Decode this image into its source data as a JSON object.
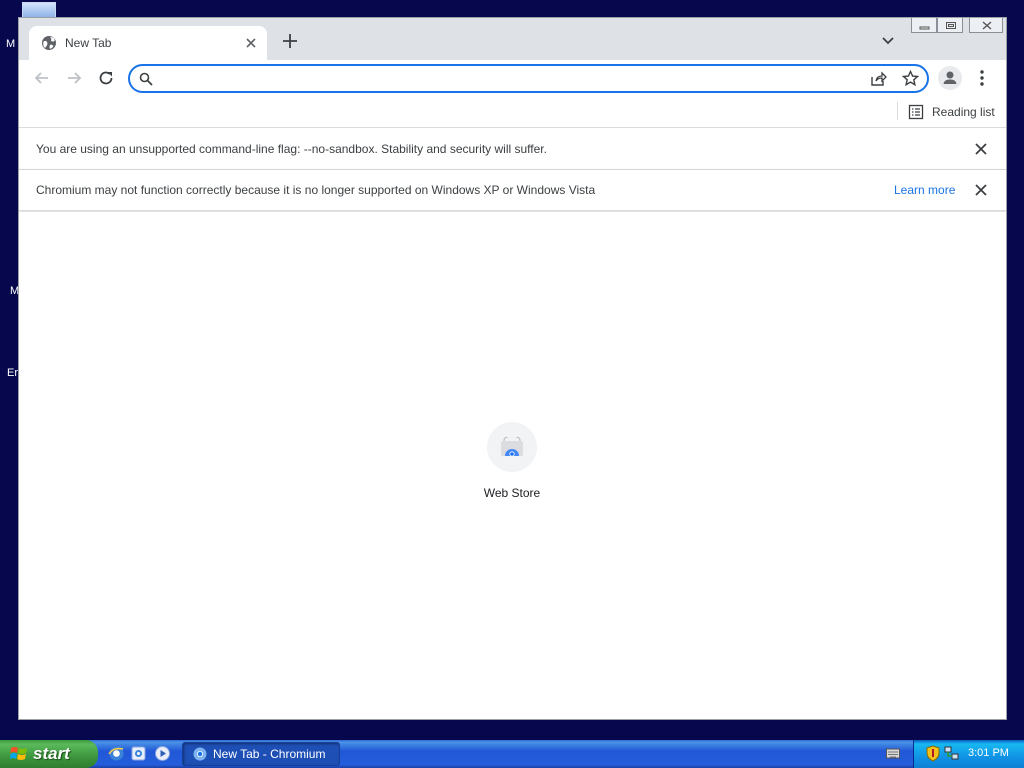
{
  "desktop": {
    "frag_1": "M",
    "frag_2": "M",
    "frag_3": "Er"
  },
  "browser": {
    "tab": {
      "title": "New Tab"
    },
    "omnibox": {
      "value": "",
      "placeholder": ""
    },
    "bookmarks_bar": {
      "reading_list_label": "Reading list"
    },
    "infobars": [
      {
        "message": "You are using an unsupported command-line flag: --no-sandbox. Stability and security will suffer."
      },
      {
        "message": "Chromium may not function correctly because it is no longer supported on Windows XP or Windows Vista",
        "link": "Learn more"
      }
    ],
    "new_tab_page": {
      "shortcuts": [
        {
          "label": "Web Store"
        }
      ]
    },
    "colors": {
      "accent": "#1a73e8",
      "tabstrip": "#dee1e6"
    }
  },
  "taskbar": {
    "start_label": "start",
    "tasks": [
      {
        "label": "New Tab - Chromium"
      }
    ],
    "clock": "3:01 PM"
  }
}
